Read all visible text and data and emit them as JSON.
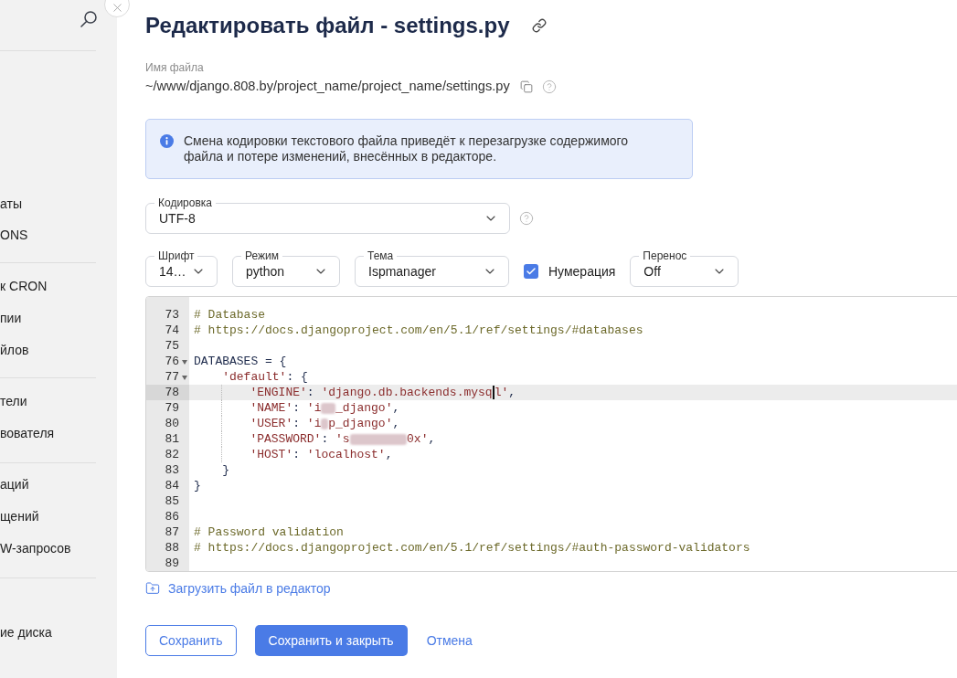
{
  "sidebar": {
    "groups": [
      {
        "items": [
          "аты",
          "ONS"
        ]
      },
      {
        "items": [
          "к CRON",
          "пии",
          "йлов"
        ]
      },
      {
        "items": [
          "тели",
          "вователя"
        ]
      },
      {
        "items": [
          "аций",
          "щений",
          "W-запросов"
        ]
      },
      {
        "items": [
          "ие диска"
        ]
      }
    ]
  },
  "title": "Редактировать файл - settings.py",
  "file_name": {
    "label": "Имя файла",
    "value": "~/www/django.808.by/project_name/project_name/settings.py"
  },
  "notice": {
    "text": "Смена кодировки текстового файла приведёт к перезагрузке содержимого файла и потере изменений, внесённых в редакторе."
  },
  "encoding": {
    "label": "Кодировка",
    "value": "UTF-8"
  },
  "editor_settings": [
    {
      "kind": "select",
      "label": "Шрифт",
      "value": "14…"
    },
    {
      "kind": "select",
      "label": "Режим",
      "value": "python"
    },
    {
      "kind": "select",
      "label": "Тема",
      "value": "Ispmanager"
    },
    {
      "kind": "checkbox",
      "label": "Нумерация",
      "checked": true
    },
    {
      "kind": "select",
      "label": "Перенос",
      "value": "Off"
    }
  ],
  "editor": {
    "lines": [
      {
        "number": "73",
        "active": false,
        "tokens": [
          {
            "kind": "comment",
            "text": "# Database"
          }
        ]
      },
      {
        "number": "74",
        "active": false,
        "tokens": [
          {
            "kind": "comment",
            "text": "# https://docs.djangoproject.com/en/5.1/ref/settings/#databases"
          }
        ]
      },
      {
        "number": "75",
        "active": false
      },
      {
        "number": "76",
        "active": false,
        "folded": false,
        "tokens": [
          {
            "kind": "plain",
            "text": "DATABASES = {"
          }
        ],
        "children": [
          {
            "number": "77",
            "active": false,
            "folded": false,
            "tokens": [
              {
                "kind": "string",
                "text": "'default'"
              },
              {
                "kind": "plain",
                "text": ": {"
              }
            ],
            "children": [
              {
                "number": "78",
                "active": true,
                "tokens": [
                  {
                    "kind": "string",
                    "text": "'ENGINE'"
                  },
                  {
                    "kind": "plain",
                    "text": ": "
                  },
                  {
                    "kind": "string",
                    "text": "'django.db.backends.mysq"
                  },
                  {
                    "kind": "cursor"
                  },
                  {
                    "kind": "string",
                    "text": "l'"
                  },
                  {
                    "kind": "plain",
                    "text": ","
                  }
                ]
              },
              {
                "number": "79",
                "active": false,
                "tokens": [
                  {
                    "kind": "string",
                    "text": "'NAME'"
                  },
                  {
                    "kind": "plain",
                    "text": ": "
                  },
                  {
                    "kind": "string",
                    "text": "'i"
                  },
                  {
                    "kind": "redacted"
                  },
                  {
                    "kind": "redacted"
                  },
                  {
                    "kind": "string",
                    "text": "_django'"
                  },
                  {
                    "kind": "plain",
                    "text": ","
                  }
                ]
              },
              {
                "number": "80",
                "active": false,
                "tokens": [
                  {
                    "kind": "string",
                    "text": "'USER'"
                  },
                  {
                    "kind": "plain",
                    "text": ": "
                  },
                  {
                    "kind": "string",
                    "text": "'i"
                  },
                  {
                    "kind": "redacted"
                  },
                  {
                    "kind": "string",
                    "text": "p_django'"
                  },
                  {
                    "kind": "plain",
                    "text": ","
                  }
                ]
              },
              {
                "number": "81",
                "active": false,
                "tokens": [
                  {
                    "kind": "string",
                    "text": "'PASSWORD'"
                  },
                  {
                    "kind": "plain",
                    "text": ": "
                  },
                  {
                    "kind": "string",
                    "text": "'s"
                  },
                  {
                    "kind": "redacted"
                  },
                  {
                    "kind": "redacted"
                  },
                  {
                    "kind": "redacted"
                  },
                  {
                    "kind": "redacted"
                  },
                  {
                    "kind": "redacted"
                  },
                  {
                    "kind": "redacted"
                  },
                  {
                    "kind": "redacted"
                  },
                  {
                    "kind": "redacted"
                  },
                  {
                    "kind": "string",
                    "text": "0x'"
                  },
                  {
                    "kind": "plain",
                    "text": ","
                  }
                ]
              },
              {
                "number": "82",
                "active": false,
                "tokens": [
                  {
                    "kind": "string",
                    "text": "'HOST'"
                  },
                  {
                    "kind": "plain",
                    "text": ": "
                  },
                  {
                    "kind": "string",
                    "text": "'localhost'"
                  },
                  {
                    "kind": "plain",
                    "text": ","
                  }
                ]
              }
            ]
          },
          {
            "number": "83",
            "active": false,
            "tokens": [
              {
                "kind": "plain",
                "text": "}"
              }
            ]
          }
        ]
      },
      {
        "number": "84",
        "active": false,
        "tokens": [
          {
            "kind": "plain",
            "text": "}"
          }
        ]
      },
      {
        "number": "85",
        "active": false
      },
      {
        "number": "86",
        "active": false
      },
      {
        "number": "87",
        "active": false,
        "tokens": [
          {
            "kind": "comment",
            "text": "# Password validation"
          }
        ]
      },
      {
        "number": "88",
        "active": false,
        "tokens": [
          {
            "kind": "comment",
            "text": "# https://docs.djangoproject.com/en/5.1/ref/settings/#auth-password-validators"
          }
        ]
      },
      {
        "number": "89",
        "active": false
      }
    ]
  },
  "upload_link": "Загрузить файл в редактор",
  "buttons": [
    {
      "kind": "secondary",
      "label": "Сохранить"
    },
    {
      "kind": "primary",
      "label": "Сохранить и закрыть"
    },
    {
      "kind": "link",
      "label": "Отмена"
    }
  ]
}
